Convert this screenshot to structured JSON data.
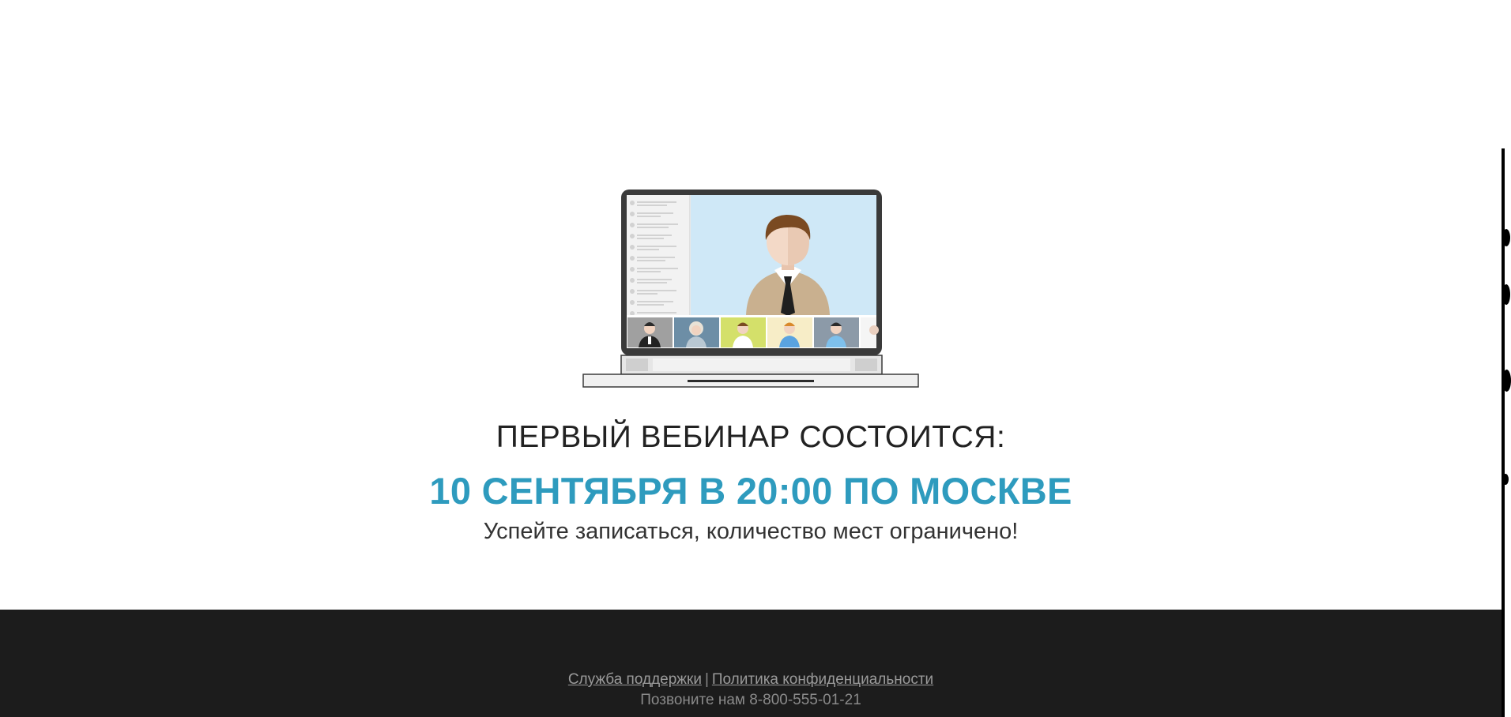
{
  "hero": {
    "headline": "ПЕРВЫЙ ВЕБИНАР СОСТОИТСЯ:",
    "date": "10 СЕНТЯБРЯ В 20:00 ПО МОСКВЕ",
    "subtext": "Успейте записаться, количество мест ограничено!",
    "illustration_icon": "laptop-video-conference-icon"
  },
  "footer": {
    "support_link": "Служба поддержки",
    "separator": "|",
    "privacy_link": "Политика конфиденциальности",
    "phone_text": "Позвоните нам 8-800-555-01-21"
  },
  "colors": {
    "accent": "#2e9bbe",
    "footer_bg": "#1c1c1c",
    "text_dark": "#222222"
  }
}
